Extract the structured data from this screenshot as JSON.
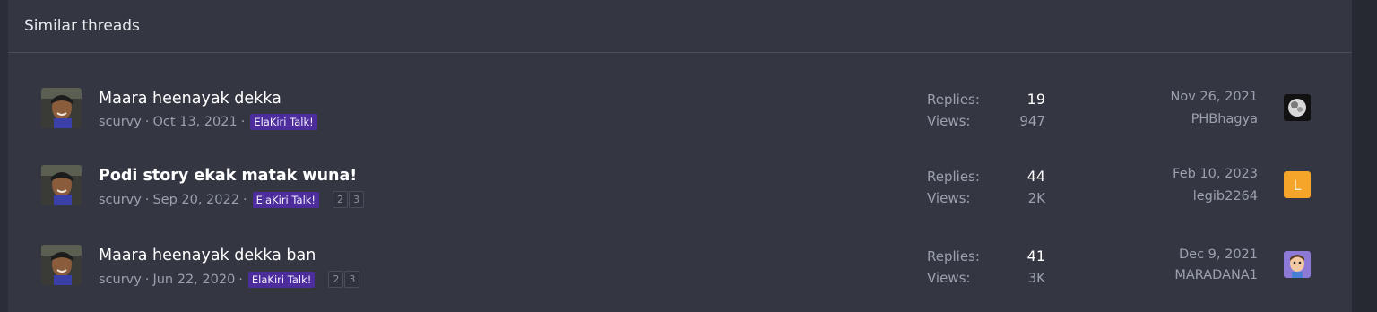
{
  "block": {
    "title": "Similar threads"
  },
  "threads": [
    {
      "title": "Maara heenayak dekka",
      "bold": false,
      "author": "scurvy",
      "date": "Oct 13, 2021",
      "prefix": "ElaKiri Talk!",
      "pages": [],
      "replies_label": "Replies:",
      "replies": "19",
      "views_label": "Views:",
      "views": "947",
      "last_date": "Nov 26, 2021",
      "last_user": "PHBhagya",
      "last_avatar": "photo"
    },
    {
      "title": "Podi story ekak matak wuna!",
      "bold": true,
      "author": "scurvy",
      "date": "Sep 20, 2022",
      "prefix": "ElaKiri Talk!",
      "pages": [
        "2",
        "3"
      ],
      "replies_label": "Replies:",
      "replies": "44",
      "views_label": "Views:",
      "views": "2K",
      "last_date": "Feb 10, 2023",
      "last_user": "legib2264",
      "last_avatar": "L"
    },
    {
      "title": "Maara heenayak dekka ban",
      "bold": false,
      "author": "scurvy",
      "date": "Jun 22, 2020",
      "prefix": "ElaKiri Talk!",
      "pages": [
        "2",
        "3"
      ],
      "replies_label": "Replies:",
      "replies": "41",
      "views_label": "Views:",
      "views": "3K",
      "last_date": "Dec 9, 2021",
      "last_user": "MARADANA1",
      "last_avatar": "cartoon"
    }
  ],
  "colors": {
    "prefix_bg": "#4d2d9c",
    "letter_avatar_bg": "#f4a52a",
    "panel_bg": "#343742"
  }
}
